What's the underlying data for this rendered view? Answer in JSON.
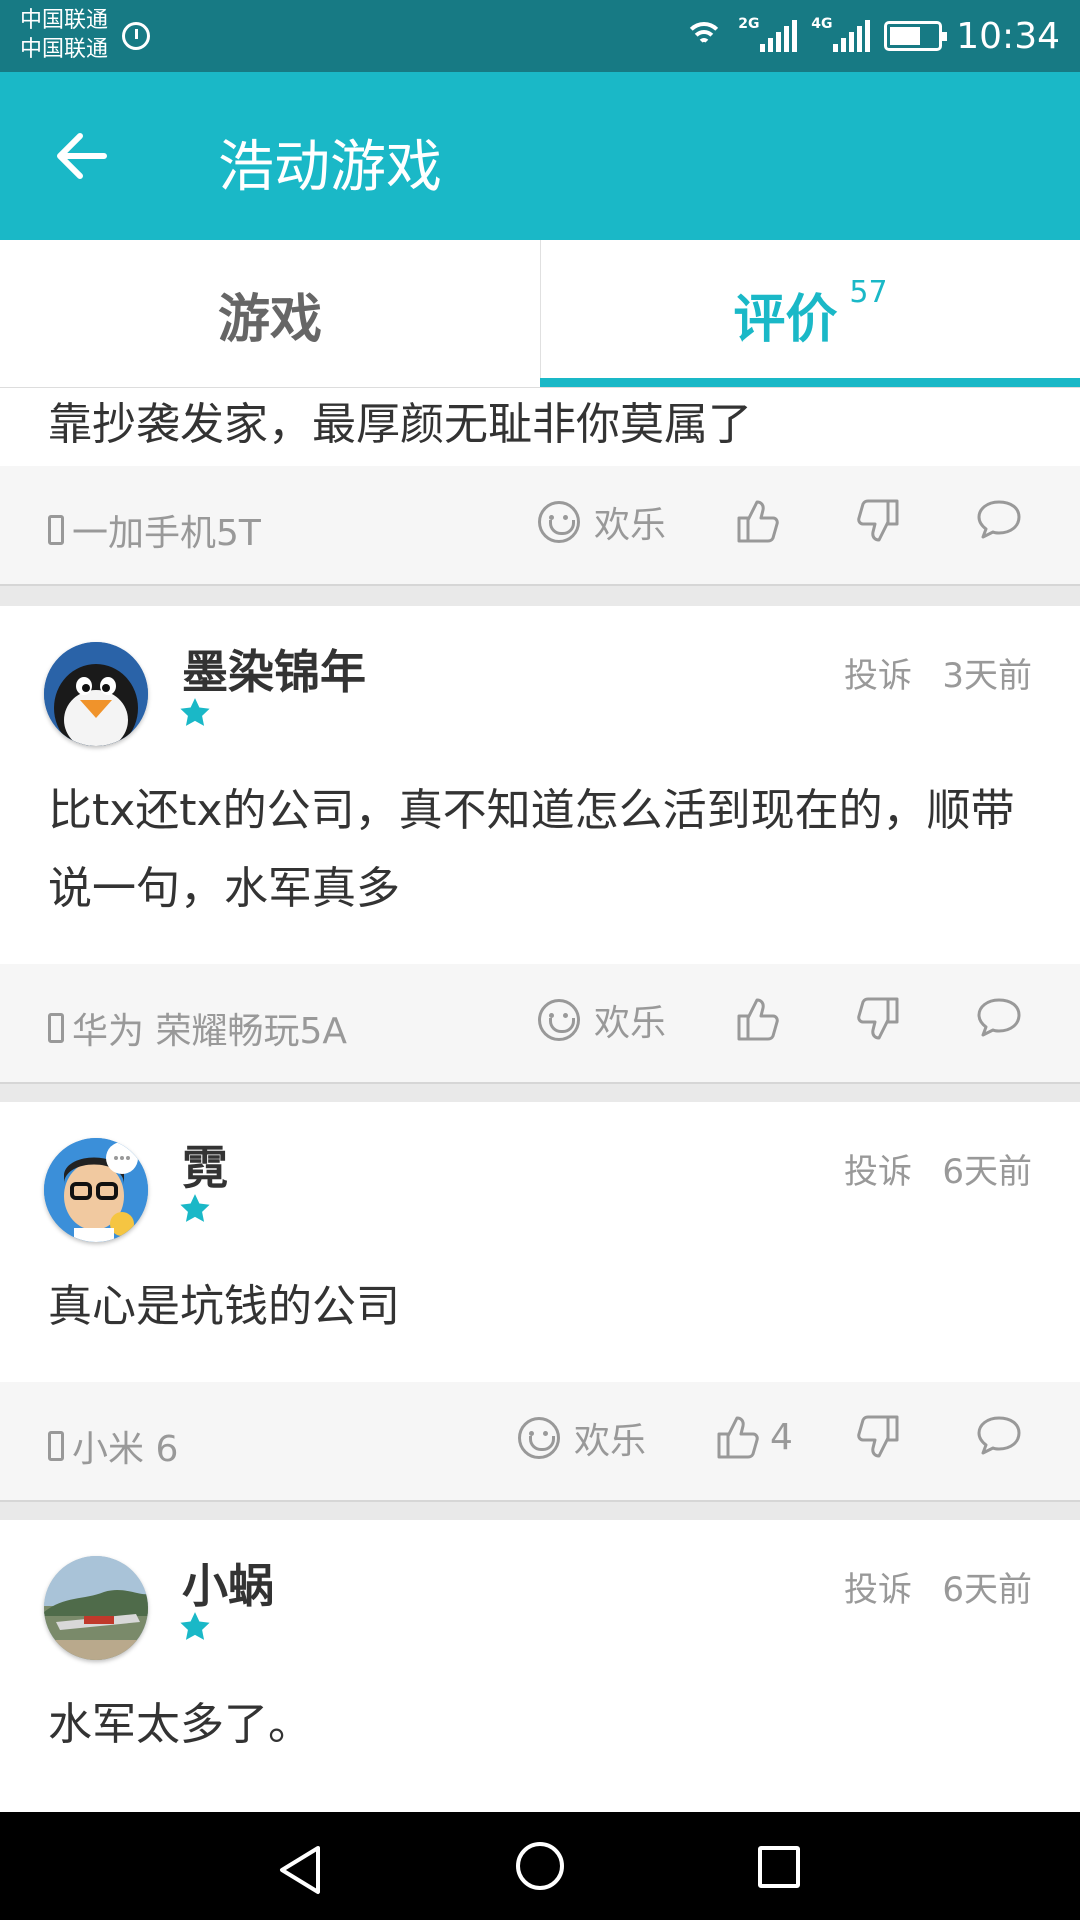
{
  "status_bar": {
    "carrier1": "中国联通",
    "carrier2": "中国联通",
    "signal1_tag": "2G",
    "signal2_tag": "4G",
    "time": "10:34"
  },
  "app_bar": {
    "title": "浩动游戏"
  },
  "tabs": {
    "game_label": "游戏",
    "review_label": "评价",
    "review_count": "57"
  },
  "partial_review": {
    "content": "靠抄袭发家，最厚颜无耻非你莫属了",
    "device": "一加手机5T",
    "mood": "欢乐"
  },
  "reviews": [
    {
      "username": "墨染锦年",
      "report": "投诉",
      "time": "3天前",
      "content": "比tx还tx的公司，真不知道怎么活到现在的，顺带说一句，水军真多",
      "device": "华为 荣耀畅玩5A",
      "mood": "欢乐",
      "likes": ""
    },
    {
      "username": "霓",
      "report": "投诉",
      "time": "6天前",
      "content": "真心是坑钱的公司",
      "device": "小米 6",
      "mood": "欢乐",
      "likes": "4"
    },
    {
      "username": "小蜗",
      "report": "投诉",
      "time": "6天前",
      "content": "水军太多了。"
    }
  ],
  "colors": {
    "accent": "#1ab8c7",
    "status_bar": "#177a84"
  }
}
